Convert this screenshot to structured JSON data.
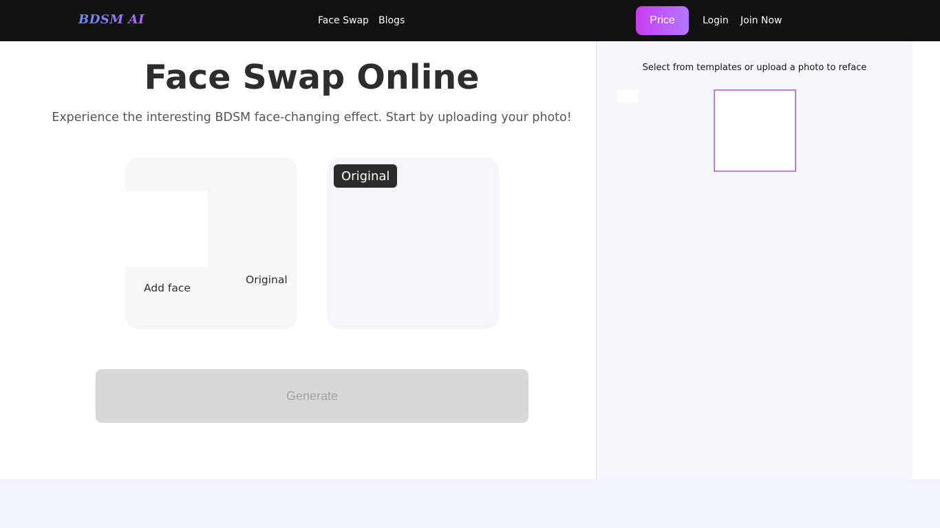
{
  "nav": {
    "logo": "BDSM AI",
    "links": [
      "Face Swap",
      "Blogs"
    ],
    "price_label": "Price",
    "login_label": "Login",
    "join_label": "Join Now"
  },
  "main": {
    "title": "Face Swap Online",
    "subtitle": "Experience the interesting BDSM face-changing effect. Start by uploading your photo!",
    "add_face_label": "Add face",
    "original_label": "Original",
    "original_badge": "Original",
    "generate_label": "Generate"
  },
  "sidebar": {
    "instruction": "Select from templates or upload a photo to reface"
  },
  "colors": {
    "accent": "#c83cf0",
    "upload_border": "#b77ee6"
  }
}
